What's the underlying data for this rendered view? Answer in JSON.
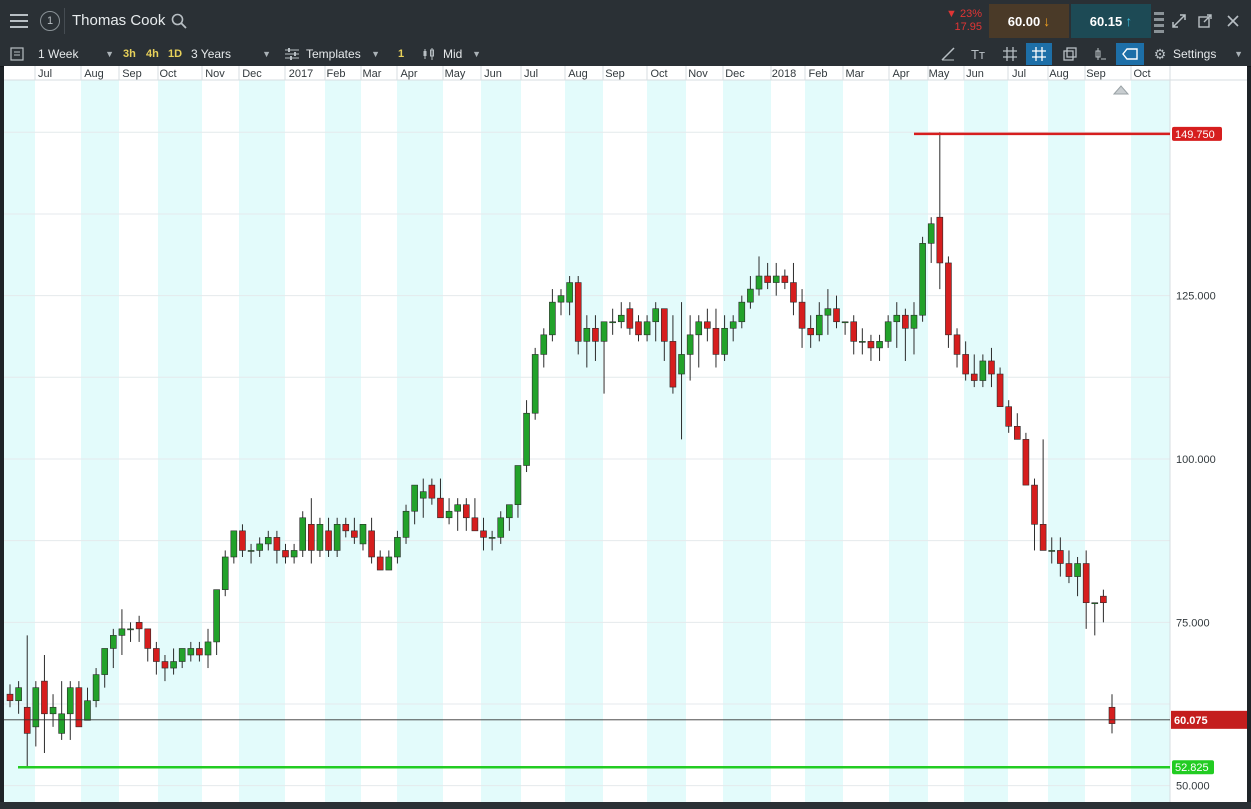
{
  "header": {
    "instrument": "Thomas Cook",
    "alert_count": "1",
    "change_pct": "▼ 23%",
    "change_abs": "17.95",
    "sell_price": "60.00",
    "buy_price": "60.15"
  },
  "toolbar": {
    "timeframe": "1 Week",
    "intervals": [
      "3h",
      "4h",
      "1D"
    ],
    "range": "3 Years",
    "templates_label": "Templates",
    "count_badge": "1",
    "price_type": "Mid",
    "settings_label": "Settings"
  },
  "colors": {
    "up": "#22a22a",
    "down": "#d61e1e",
    "resistance": "#d61e1e",
    "support": "#22cc22",
    "band": "#e3fbfb",
    "current_price_bg": "#c41e1e",
    "accent_blue": "#1d6fa8"
  },
  "chart_data": {
    "type": "candlestick",
    "title": "Thomas Cook",
    "x_labels": [
      "Jul",
      "Aug",
      "Sep",
      "Oct",
      "Nov",
      "Dec",
      "2017",
      "Feb",
      "Mar",
      "Apr",
      "May",
      "Jun",
      "Jul",
      "Aug",
      "Sep",
      "Oct",
      "Nov",
      "Dec",
      "2018",
      "Feb",
      "Mar",
      "Apr",
      "May",
      "Jun",
      "Jul",
      "Aug",
      "Sep",
      "Oct"
    ],
    "y_ticks": [
      50,
      75,
      100,
      125
    ],
    "y_tick_labels": [
      "50.000",
      "75.000",
      "100.000",
      "125.000"
    ],
    "ylim": [
      47.5,
      158
    ],
    "grid": true,
    "levels": [
      {
        "label": "149.750",
        "value": 149.75,
        "role": "resistance"
      },
      {
        "label": "52.825",
        "value": 52.825,
        "role": "support"
      }
    ],
    "current_price": {
      "label": "60.075",
      "value": 60.075
    },
    "candles": [
      [
        64,
        65.5,
        62,
        63
      ],
      [
        63,
        66,
        61,
        65
      ],
      [
        62,
        73,
        53,
        58
      ],
      [
        59,
        66,
        56,
        65
      ],
      [
        66,
        70,
        55,
        61
      ],
      [
        61,
        64,
        59,
        62
      ],
      [
        58,
        66,
        57,
        61
      ],
      [
        61,
        66,
        57,
        65
      ],
      [
        65,
        66,
        59,
        59
      ],
      [
        60,
        65,
        60,
        63
      ],
      [
        63,
        68,
        62,
        67
      ],
      [
        67,
        71,
        65,
        71
      ],
      [
        71,
        74,
        68,
        73
      ],
      [
        73,
        77,
        70,
        74
      ],
      [
        74,
        75,
        72,
        74
      ],
      [
        75,
        76,
        72,
        74
      ],
      [
        74,
        74,
        69,
        71
      ],
      [
        71,
        72,
        67,
        69
      ],
      [
        69,
        70,
        66,
        68
      ],
      [
        68,
        71,
        67,
        69
      ],
      [
        69,
        71,
        68,
        71
      ],
      [
        70,
        72,
        69,
        71
      ],
      [
        71,
        72,
        69,
        70
      ],
      [
        70,
        74,
        68,
        72
      ],
      [
        72,
        80,
        70,
        80
      ],
      [
        80,
        86,
        79,
        85
      ],
      [
        85,
        89,
        84,
        89
      ],
      [
        89,
        90,
        85,
        86
      ],
      [
        86,
        87,
        84,
        86
      ],
      [
        86,
        88,
        85,
        87
      ],
      [
        87,
        89,
        86,
        88
      ],
      [
        88,
        89,
        84,
        86
      ],
      [
        86,
        87,
        84,
        85
      ],
      [
        85,
        87,
        84,
        86
      ],
      [
        86,
        92,
        85,
        91
      ],
      [
        90,
        94,
        84,
        86
      ],
      [
        86,
        91,
        85,
        90
      ],
      [
        89,
        91,
        85,
        86
      ],
      [
        86,
        91,
        85,
        90
      ],
      [
        90,
        91,
        88,
        89
      ],
      [
        89,
        91,
        87,
        88
      ],
      [
        87,
        90,
        86,
        90
      ],
      [
        89,
        91,
        84,
        85
      ],
      [
        85,
        86,
        83,
        83
      ],
      [
        83,
        86,
        83,
        85
      ],
      [
        85,
        89,
        84,
        88
      ],
      [
        88,
        93,
        87,
        92
      ],
      [
        92,
        96,
        90,
        96
      ],
      [
        94,
        97,
        91,
        95
      ],
      [
        96,
        97,
        93,
        94
      ],
      [
        94,
        97,
        91,
        91
      ],
      [
        91,
        94,
        90,
        92
      ],
      [
        92,
        94,
        89,
        93
      ],
      [
        93,
        94,
        89,
        91
      ],
      [
        91,
        94,
        89,
        89
      ],
      [
        89,
        91,
        86,
        88
      ],
      [
        88,
        89,
        86,
        88
      ],
      [
        88,
        92,
        87,
        91
      ],
      [
        91,
        93,
        89,
        93
      ],
      [
        93,
        98,
        91,
        99
      ],
      [
        99,
        109,
        98,
        107
      ],
      [
        107,
        117,
        106,
        116
      ],
      [
        116,
        120,
        114,
        119
      ],
      [
        119,
        126,
        118,
        124
      ],
      [
        124,
        126,
        122,
        125
      ],
      [
        124,
        128,
        122,
        127
      ],
      [
        127,
        128,
        116,
        118
      ],
      [
        118,
        122,
        114,
        120
      ],
      [
        120,
        122,
        115,
        118
      ],
      [
        118,
        120,
        110,
        121
      ],
      [
        121,
        123,
        119,
        121
      ],
      [
        121,
        124,
        120,
        122
      ],
      [
        123,
        124,
        119,
        120
      ],
      [
        121,
        122,
        118,
        119
      ],
      [
        119,
        122,
        118,
        121
      ],
      [
        121,
        124,
        118,
        123
      ],
      [
        123,
        123,
        115,
        118
      ],
      [
        118,
        122,
        110,
        111
      ],
      [
        113,
        124,
        103,
        116
      ],
      [
        116,
        122,
        112,
        119
      ],
      [
        119,
        122,
        114,
        121
      ],
      [
        121,
        123,
        118,
        120
      ],
      [
        120,
        123,
        114,
        116
      ],
      [
        116,
        122,
        115,
        120
      ],
      [
        120,
        122,
        118,
        121
      ],
      [
        121,
        125,
        120,
        124
      ],
      [
        124,
        128,
        123,
        126
      ],
      [
        126,
        131,
        125,
        128
      ],
      [
        128,
        130,
        126,
        127
      ],
      [
        127,
        130,
        125,
        128
      ],
      [
        128,
        129,
        126,
        127
      ],
      [
        127,
        130,
        122,
        124
      ],
      [
        124,
        126,
        117,
        120
      ],
      [
        120,
        122,
        117,
        119
      ],
      [
        119,
        124,
        118,
        122
      ],
      [
        122,
        126,
        119,
        123
      ],
      [
        123,
        125,
        120,
        121
      ],
      [
        121,
        121,
        119,
        121
      ],
      [
        121,
        122,
        116,
        118
      ],
      [
        118,
        120,
        116,
        118
      ],
      [
        118,
        119,
        115,
        117
      ],
      [
        117,
        119,
        115,
        118
      ],
      [
        118,
        122,
        117,
        121
      ],
      [
        121,
        124,
        117,
        122
      ],
      [
        122,
        123,
        115,
        120
      ],
      [
        120,
        124,
        116,
        122
      ],
      [
        122,
        134,
        121,
        133
      ],
      [
        133,
        137,
        130,
        136
      ],
      [
        137,
        150,
        126,
        130
      ],
      [
        130,
        131,
        117,
        119
      ],
      [
        119,
        120,
        114,
        116
      ],
      [
        116,
        118,
        112,
        113
      ],
      [
        113,
        116,
        111,
        112
      ],
      [
        112,
        116,
        111,
        115
      ],
      [
        115,
        117,
        111,
        113
      ],
      [
        113,
        114,
        108,
        108
      ],
      [
        108,
        109,
        104,
        105
      ],
      [
        105,
        107,
        103,
        103
      ],
      [
        103,
        104,
        96,
        96
      ],
      [
        96,
        97,
        86,
        90
      ],
      [
        90,
        103,
        88,
        86
      ],
      [
        86,
        88,
        84,
        86
      ],
      [
        86,
        88,
        82,
        84
      ],
      [
        84,
        86,
        81,
        82
      ],
      [
        82,
        85,
        79,
        84
      ],
      [
        84,
        86,
        74,
        78
      ],
      [
        78,
        78,
        73,
        78
      ],
      [
        79,
        80,
        75,
        78
      ],
      [
        62,
        64,
        58,
        59.5
      ]
    ]
  }
}
